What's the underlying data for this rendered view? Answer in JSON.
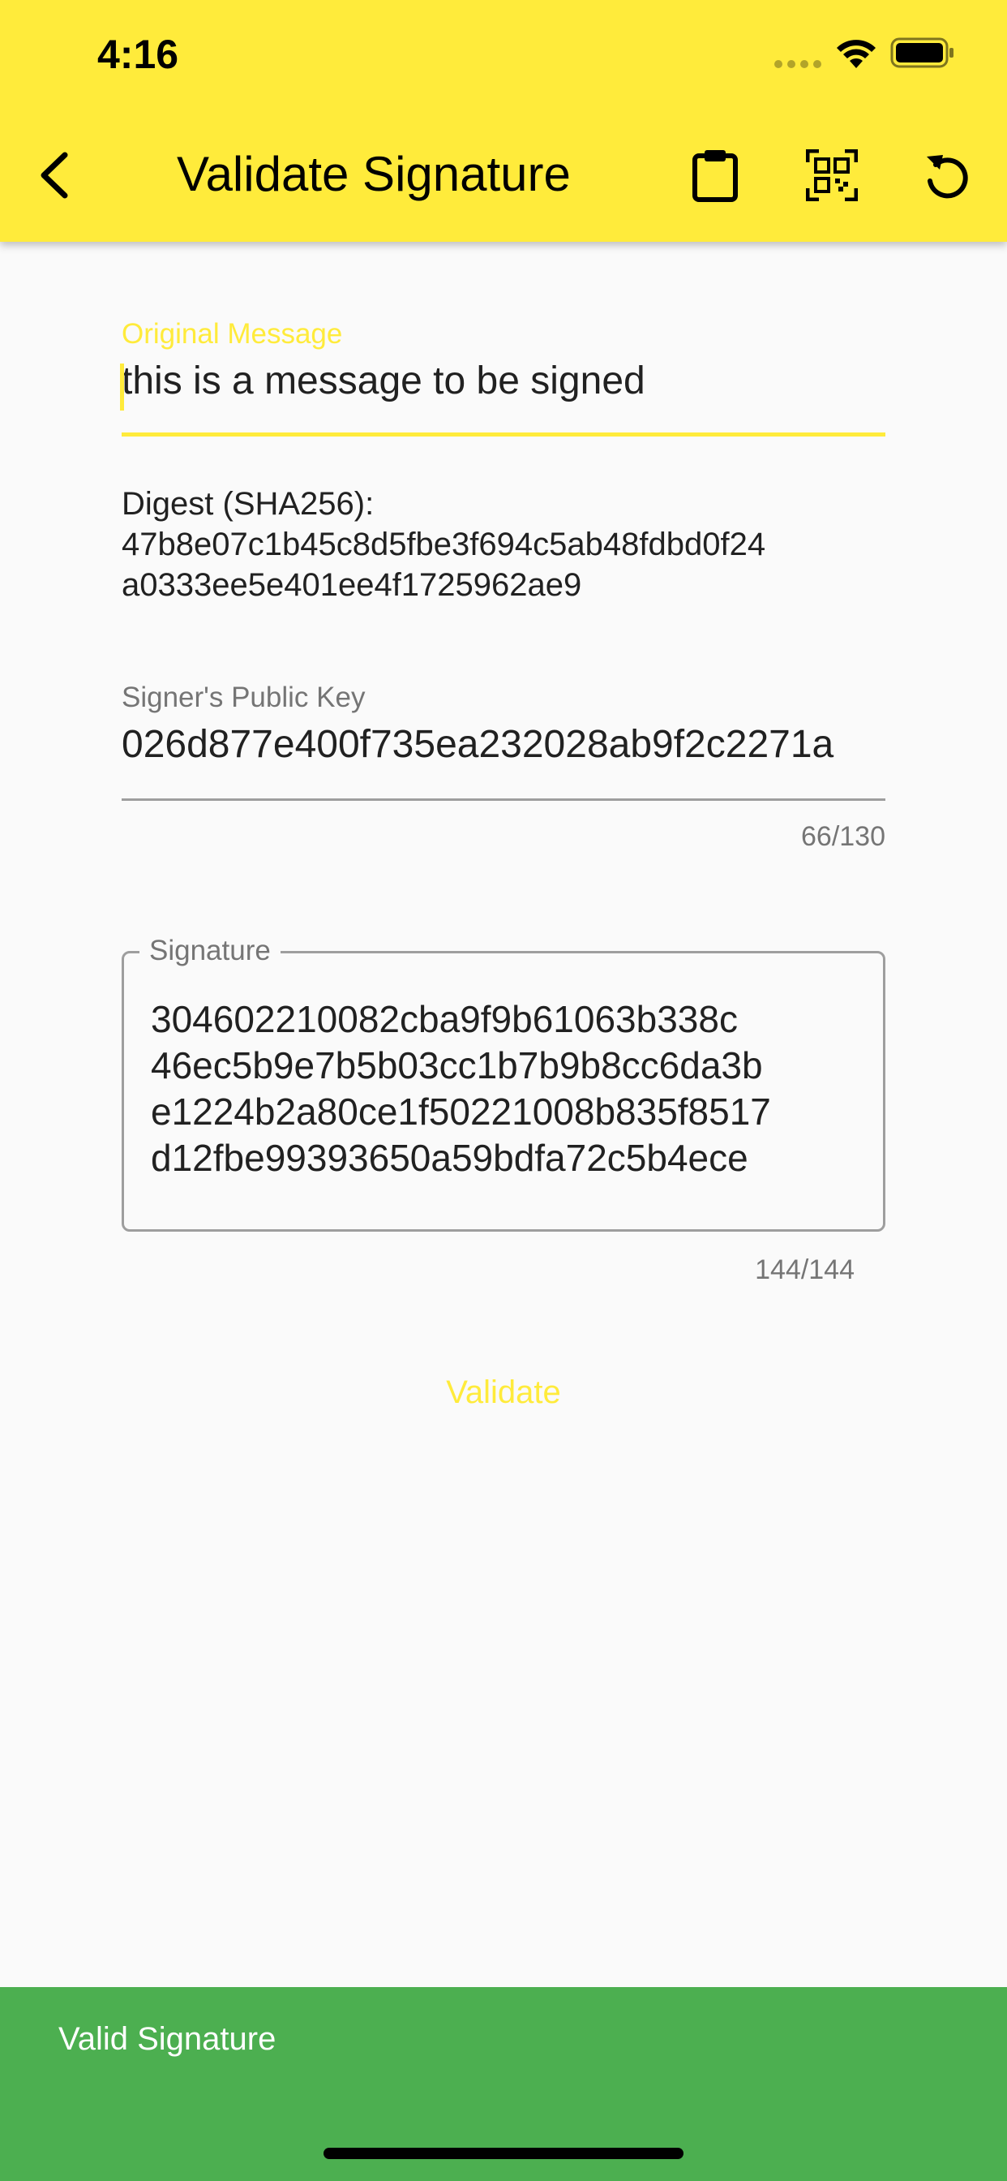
{
  "status_bar": {
    "time": "4:16"
  },
  "app_bar": {
    "title": "Validate Signature",
    "background_color": "#ffeb3b",
    "icons": [
      "back-arrow-icon",
      "clipboard-icon",
      "qr-code-scan-icon",
      "reset-icon"
    ]
  },
  "form": {
    "original_message": {
      "label": "Original Message",
      "value": "this is a message to be signed",
      "accent_color": "#ffeb3b"
    },
    "digest": {
      "label": "Digest (SHA256):",
      "lines": [
        "47b8e07c1b45c8d5fbe3f694c5ab48fdbd0f24",
        "a0333ee5e401ee4f1725962ae9"
      ]
    },
    "public_key": {
      "label": "Signer's Public Key",
      "value": "026d877e400f735ea232028ab9f2c2271a",
      "counter": "66/130"
    },
    "signature": {
      "label": "Signature",
      "lines": [
        "304602210082cba9f9b61063b338c",
        "46ec5b9e7b5b03cc1b7b9b8cc6da3b",
        "e1224b2a80ce1f50221008b835f8517",
        "d12fbe99393650a59bdfa72c5b4ece"
      ],
      "counter": "144/144"
    },
    "validate_label": "Validate"
  },
  "snackbar": {
    "message": "Valid Signature",
    "color": "#4caf50"
  }
}
